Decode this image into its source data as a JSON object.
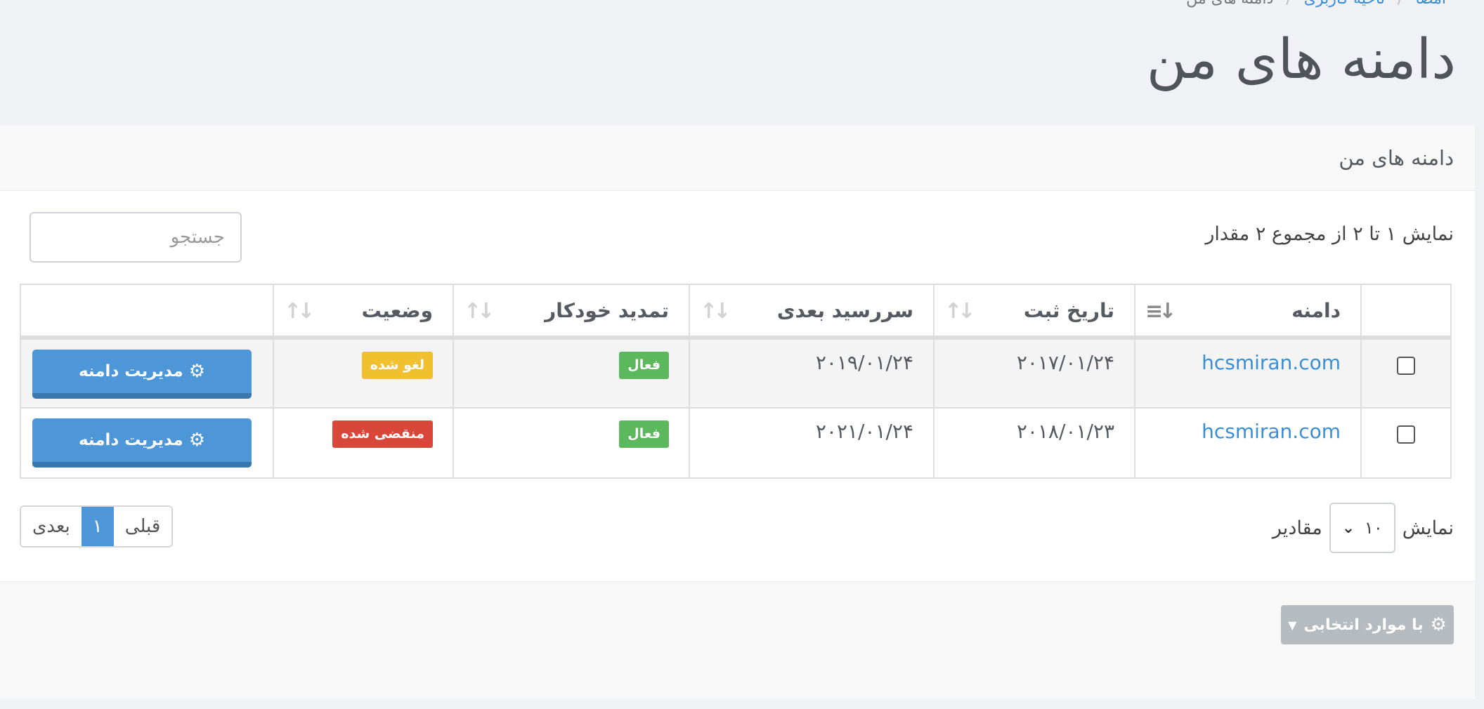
{
  "breadcrumb": {
    "items": [
      "امضا",
      "ناحیه کاربری",
      "دامنه های من"
    ]
  },
  "page_title": "دامنه های من",
  "panel": {
    "heading": "دامنه های من",
    "info": "نمایش ۱ تا ۲ از مجموع ۲ مقدار",
    "search_placeholder": "جستجو"
  },
  "table": {
    "headers": {
      "domain": "دامنه",
      "reg_date": "تاریخ ثبت",
      "next_due": "سررسید بعدی",
      "auto_renew": "تمدید خودکار",
      "status": "وضعیت"
    },
    "rows": [
      {
        "domain": "hcsmiran.com",
        "reg_date": "۲۰۱۷/۰۱/۲۴",
        "next_due": "۲۰۱۹/۰۱/۲۴",
        "auto_renew": "فعال",
        "status": "لغو شده",
        "status_color": "#f0c02e",
        "action": "مدیریت دامنه"
      },
      {
        "domain": "hcsmiran.com",
        "reg_date": "۲۰۱۸/۰۱/۲۳",
        "next_due": "۲۰۲۱/۰۱/۲۴",
        "auto_renew": "فعال",
        "status": "منقضی شده",
        "status_color": "#d9473a",
        "action": "مدیریت دامنه"
      }
    ]
  },
  "length_menu": {
    "prefix": "نمایش",
    "value": "۱۰",
    "suffix": "مقادیر"
  },
  "pagination": {
    "prev": "قبلی",
    "current": "۱",
    "next": "بعدی"
  },
  "bulk_action": {
    "label": "با موارد انتخابی",
    "icon": "gear-icon"
  },
  "colors": {
    "accent": "#4d96d7",
    "link": "#3b8ed4",
    "success": "#5cb85c"
  }
}
